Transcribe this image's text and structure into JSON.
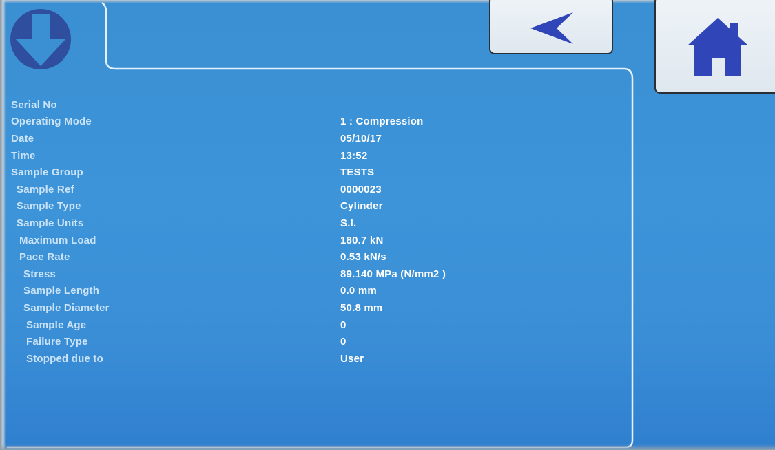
{
  "nav": {
    "down_icon": "arrow-down-circle-icon",
    "back_icon": "arrow-left-icon",
    "home_icon": "home-icon",
    "accent_color": "#2f4f9e"
  },
  "details": [
    {
      "label": "Serial No",
      "value": ""
    },
    {
      "label": "Operating Mode",
      "value": "1 : Compression"
    },
    {
      "label": "Date",
      "value": "05/10/17"
    },
    {
      "label": "Time",
      "value": "13:52"
    },
    {
      "label": "Sample Group",
      "value": "TESTS"
    },
    {
      "label": "Sample Ref",
      "value": "0000023"
    },
    {
      "label": "Sample Type",
      "value": "Cylinder"
    },
    {
      "label": "Sample Units",
      "value": "S.I."
    },
    {
      "label": "Maximum Load",
      "value": "180.7 kN"
    },
    {
      "label": "Pace Rate",
      "value": "0.53 kN/s"
    },
    {
      "label": "Stress",
      "value": "89.140 MPa (N/mm2 )"
    },
    {
      "label": "Sample Length",
      "value": "0.0 mm"
    },
    {
      "label": "Sample Diameter",
      "value": "50.8 mm"
    },
    {
      "label": "Sample Age",
      "value": "0"
    },
    {
      "label": "Failure Type",
      "value": "0"
    },
    {
      "label": "Stopped due to",
      "value": "User"
    }
  ]
}
